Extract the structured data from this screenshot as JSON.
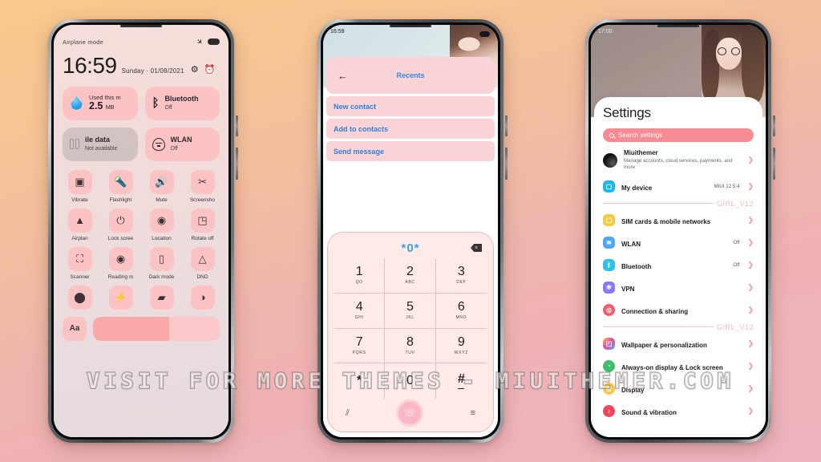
{
  "watermark": "VISIT FOR MORE THEMES - MIUITHEMER.COM",
  "theme": {
    "accent_pink": "#fbc3c4",
    "accent_hot_pink": "#f88a92",
    "link_blue": "#2f87e8",
    "background_top": "#f8c88c",
    "background_bottom": "#edb3bd"
  },
  "phone1": {
    "status": {
      "label": "Airplane mode",
      "airplane_icon": "airplane-icon",
      "battery_icon": "battery-icon"
    },
    "clock": {
      "time": "16:59",
      "day": "Sunday",
      "separator": "·",
      "date": "01/08/2021"
    },
    "header_icons": [
      {
        "name": "settings-gear-icon",
        "glyph": "⚙"
      },
      {
        "name": "alarm-clock-icon",
        "glyph": "⏰"
      }
    ],
    "big_tiles": [
      {
        "name": "data-usage-tile",
        "icon": "water-drop-icon",
        "top": "Used this m",
        "value": "2.5",
        "unit": "MB",
        "state": "on"
      },
      {
        "name": "bluetooth-tile",
        "icon": "bluetooth-icon",
        "title": "Bluetooth",
        "sub": "Off",
        "state": "on"
      },
      {
        "name": "mobile-data-tile",
        "icon": "sim-card-icon",
        "title": "ile data",
        "sub": "Not available",
        "state": "disabled"
      },
      {
        "name": "wlan-tile",
        "icon": "wlan-icon",
        "title": "WLAN",
        "sub": "Off",
        "state": "on"
      }
    ],
    "toggles": [
      {
        "label": "Vibrate",
        "icon": "vibrate-icon",
        "glyph": "▣"
      },
      {
        "label": "Flashlight",
        "icon": "flashlight-icon",
        "glyph": "ὒ6"
      },
      {
        "label": "Mute",
        "icon": "mute-icon",
        "glyph": "ὐ8"
      },
      {
        "label": "Screensho",
        "icon": "screenshot-icon",
        "glyph": "✂"
      },
      {
        "label": "Airplan",
        "icon": "airplane-mode-icon",
        "glyph": "▲"
      },
      {
        "label": "Lock scree",
        "icon": "lock-screen-icon",
        "glyph": "⏻"
      },
      {
        "label": "Location",
        "icon": "location-icon",
        "glyph": "◉"
      },
      {
        "label": "Rotate off",
        "icon": "rotate-icon",
        "glyph": "◰"
      },
      {
        "label": "Scanner",
        "icon": "scanner-icon",
        "glyph": "⬚"
      },
      {
        "label": "Reading m",
        "icon": "reading-mode-icon",
        "glyph": "◉"
      },
      {
        "label": "Dark mode",
        "icon": "dark-mode-icon",
        "glyph": "▯"
      },
      {
        "label": "DND",
        "icon": "do-not-disturb-icon",
        "glyph": "△"
      }
    ],
    "row4": [
      {
        "label": "",
        "icon": "headphones-icon",
        "glyph": "●"
      },
      {
        "label": "",
        "icon": "power-saver-icon",
        "glyph": "⚡"
      },
      {
        "label": "",
        "icon": "cast-icon",
        "glyph": "■"
      },
      {
        "label": "",
        "icon": "sync-icon",
        "glyph": "◑"
      }
    ],
    "brightness": {
      "icon": "font-size-icon",
      "glyph": "Aa",
      "slider_name": "brightness-slider",
      "fill_percent": 60
    }
  },
  "phone2": {
    "status": {
      "time": "16:59"
    },
    "header": {
      "back_icon": "back-arrow-icon",
      "title": "Recents"
    },
    "actions": [
      {
        "label": "New contact"
      },
      {
        "label": "Add to contacts"
      },
      {
        "label": "Send message"
      }
    ],
    "keypad": {
      "display": "*0*",
      "delete_icon": "backspace-icon",
      "keys": [
        {
          "digit": "1",
          "letters": "QO"
        },
        {
          "digit": "2",
          "letters": "ABC"
        },
        {
          "digit": "3",
          "letters": "DEF"
        },
        {
          "digit": "4",
          "letters": "GHI"
        },
        {
          "digit": "5",
          "letters": "JKL"
        },
        {
          "digit": "6",
          "letters": "MNO"
        },
        {
          "digit": "7",
          "letters": "PQRS"
        },
        {
          "digit": "8",
          "letters": "TUV"
        },
        {
          "digit": "9",
          "letters": "WXYZ"
        }
      ],
      "star": "*",
      "zero": "0",
      "hash": "#",
      "bottom": {
        "left_icon": "keypad-hide-icon",
        "call_icon": "call-icon",
        "right_icon": "menu-icon"
      }
    }
  },
  "phone3": {
    "status": {
      "time": "17:00"
    },
    "title": "Settings",
    "search": {
      "placeholder": "Search settings",
      "icon": "search-icon"
    },
    "account": {
      "name": "Miuithemer",
      "sub": "Manage accounts, cloud services, payments, and more",
      "avatar": "account-avatar"
    },
    "device": {
      "name": "My device",
      "value": "MIUI 12.5.4",
      "icon": "device-icon",
      "color": "#19b8f0"
    },
    "divider_tag": "GIRL_V12",
    "group1": [
      {
        "name": "SIM cards & mobile networks",
        "value": "",
        "icon": "sim-icon",
        "color": "#f6c93f"
      },
      {
        "name": "WLAN",
        "value": "Off",
        "icon": "wifi-icon",
        "color": "#4ea8f7"
      },
      {
        "name": "Bluetooth",
        "value": "Off",
        "icon": "bluetooth-icon",
        "color": "#2fc0f0"
      },
      {
        "name": "VPN",
        "value": "",
        "icon": "vpn-icon",
        "color": "#8b79f5"
      },
      {
        "name": "Connection & sharing",
        "value": "",
        "icon": "connection-sharing-icon",
        "color": "#f45a6d"
      }
    ],
    "group2": [
      {
        "name": "Wallpaper & personalization",
        "value": "",
        "icon": "wallpaper-icon",
        "color": "#e24fa0"
      },
      {
        "name": "Always-on display & Lock screen",
        "value": "",
        "icon": "aod-lockscreen-icon",
        "color": "#3fbf6a"
      },
      {
        "name": "Display",
        "value": "",
        "icon": "display-icon",
        "color": "#f6c93f"
      },
      {
        "name": "Sound & vibration",
        "value": "",
        "icon": "sound-vibration-icon",
        "color": "#f2435c"
      }
    ]
  }
}
